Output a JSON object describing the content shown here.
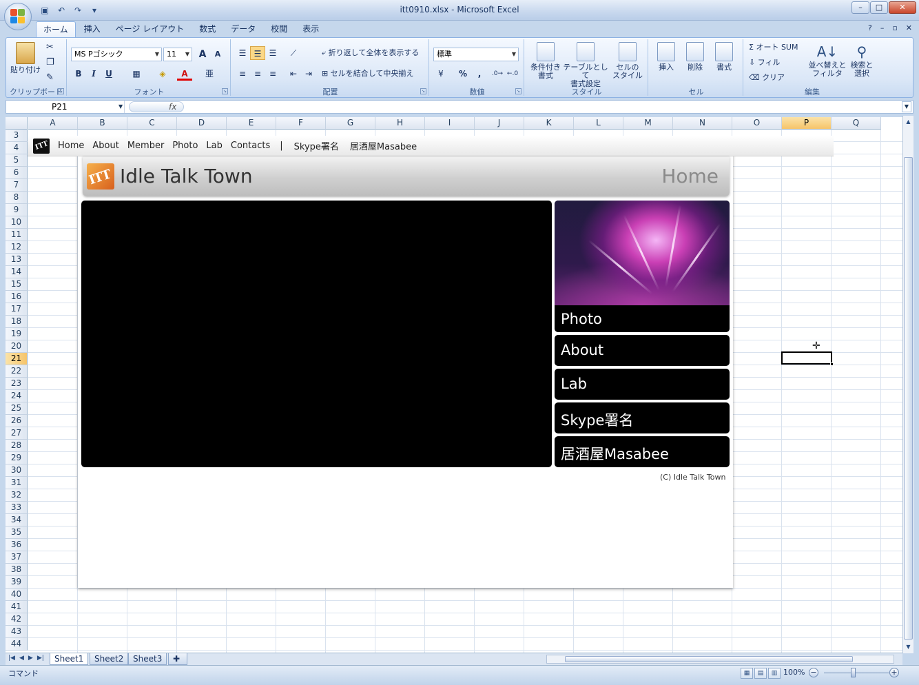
{
  "window": {
    "title": "itt0910.xlsx - Microsoft Excel",
    "minimize": "–",
    "maximize": "□",
    "close": "✕"
  },
  "qat": {
    "save_icon": "floppy-icon",
    "undo_icon": "undo-icon",
    "redo_icon": "redo-icon",
    "customize": "▾"
  },
  "ribbon_tabs": [
    {
      "label": "ホーム",
      "active": true
    },
    {
      "label": "挿入"
    },
    {
      "label": "ページ レイアウト"
    },
    {
      "label": "数式"
    },
    {
      "label": "データ"
    },
    {
      "label": "校閲"
    },
    {
      "label": "表示"
    }
  ],
  "ribbon_right": {
    "help": "?",
    "min": "–",
    "restore": "▫",
    "close": "✕"
  },
  "clipboard": {
    "paste": "貼り付け",
    "label": "クリップボード"
  },
  "font": {
    "name": "MS Pゴシック",
    "size": "11",
    "grow": "A",
    "shrink": "A",
    "bold": "B",
    "italic": "I",
    "underline": "U",
    "font_color_letter": "A",
    "label": "フォント"
  },
  "alignment": {
    "wrap": "折り返して全体を表示する",
    "merge": "セルを結合して中央揃え",
    "label": "配置"
  },
  "number": {
    "format": "標準",
    "percent": "%",
    "comma": ",",
    "label": "数値"
  },
  "styles": {
    "conditional": "条件付き\n書式",
    "conditional_l1": "条件付き",
    "conditional_l2": "書式",
    "table_l1": "テーブルとして",
    "table_l2": "書式設定",
    "cell_l1": "セルの",
    "cell_l2": "スタイル",
    "label": "スタイル"
  },
  "cells": {
    "insert": "挿入",
    "delete": "削除",
    "format": "書式",
    "label": "セル"
  },
  "editing": {
    "autosum": "オート SUM",
    "fill": "フィル",
    "clear": "クリア",
    "sort_l1": "並べ替えと",
    "sort_l2": "フィルタ",
    "find_l1": "検索と",
    "find_l2": "選択",
    "label": "編集"
  },
  "formula_bar": {
    "name_box": "P21",
    "fx": "fx",
    "value": ""
  },
  "columns": [
    "A",
    "B",
    "C",
    "D",
    "E",
    "F",
    "G",
    "H",
    "I",
    "J",
    "K",
    "L",
    "M",
    "N",
    "O",
    "P",
    "Q"
  ],
  "rows": [
    "3",
    "4",
    "5",
    "6",
    "7",
    "8",
    "9",
    "10",
    "11",
    "12",
    "13",
    "14",
    "15",
    "16",
    "17",
    "18",
    "19",
    "20",
    "21",
    "22",
    "23",
    "24",
    "25",
    "26",
    "27",
    "28",
    "29",
    "30",
    "31",
    "32",
    "33",
    "34",
    "35",
    "36",
    "37",
    "38",
    "39",
    "40",
    "41",
    "42",
    "43",
    "44"
  ],
  "selected": {
    "column": "P",
    "row": "21"
  },
  "webpage": {
    "nav": [
      "Home",
      "About",
      "Member",
      "Photo",
      "Lab",
      "Contacts"
    ],
    "nav_separator": "|",
    "nav_extra": [
      "Skype署名",
      "居酒屋Masabee"
    ],
    "logo_text": "ITT",
    "site_title": "Idle Talk Town",
    "page_label": "Home",
    "side_items": [
      "Photo",
      "About",
      "Lab",
      "Skype署名",
      "居酒屋Masabee"
    ],
    "copyright": "(C) Idle Talk Town"
  },
  "sheets": [
    "Sheet1",
    "Sheet2",
    "Sheet3"
  ],
  "active_sheet": "Sheet1",
  "status": {
    "mode": "コマンド",
    "zoom": "100%",
    "zoom_minus": "−",
    "zoom_plus": "+"
  }
}
